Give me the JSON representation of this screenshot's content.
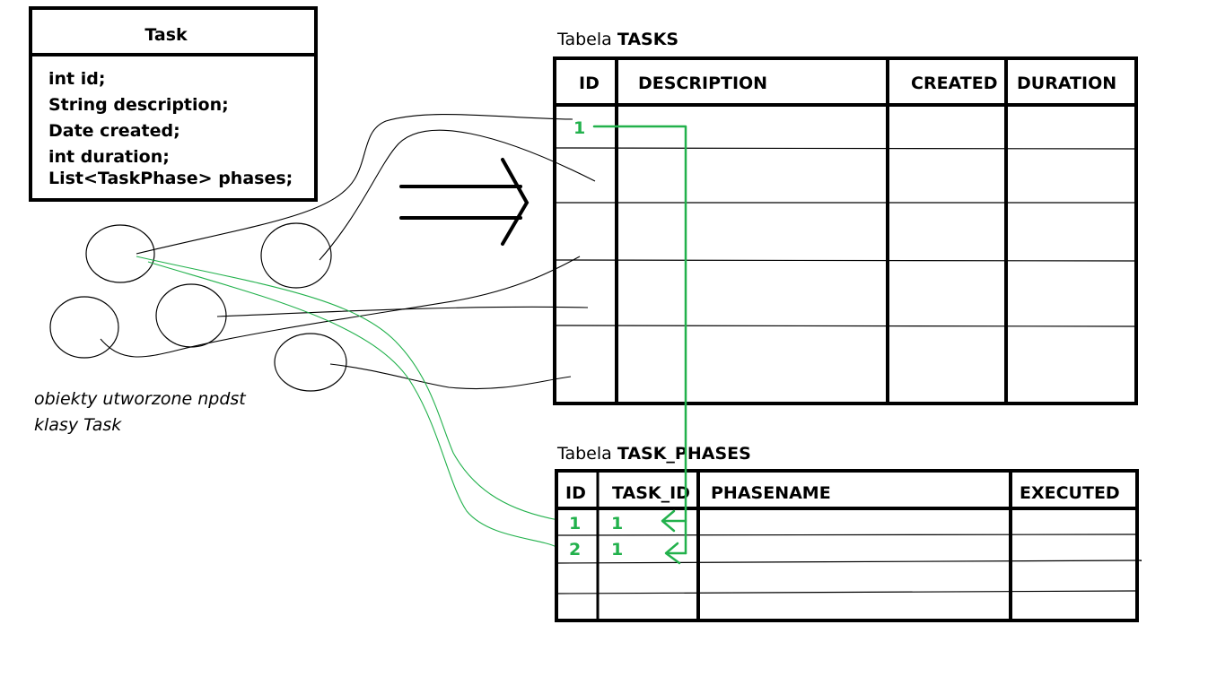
{
  "class_box": {
    "title": "Task",
    "fields": [
      "int id;",
      "String description;",
      "Date created;",
      "int duration;",
      "List<TaskPhase> phases;"
    ]
  },
  "objects_caption": {
    "line1": "obiekty utworzone npdst",
    "line2": "klasy Task"
  },
  "tasks_table": {
    "caption_prefix": "Tabela ",
    "caption_name": "TASKS",
    "headers": [
      "ID",
      "DESCRIPTION",
      "CREATED",
      "DURATION"
    ],
    "row1_id": "1"
  },
  "phases_table": {
    "caption_prefix": "Tabela ",
    "caption_name": "TASK_PHASES",
    "headers": [
      "ID",
      "TASK_ID",
      "PHASENAME",
      "EXECUTED"
    ],
    "rows": [
      {
        "id": "1",
        "task_id": "1"
      },
      {
        "id": "2",
        "task_id": "1"
      }
    ]
  },
  "colors": {
    "ink": "#000000",
    "highlight": "#22b14c"
  }
}
